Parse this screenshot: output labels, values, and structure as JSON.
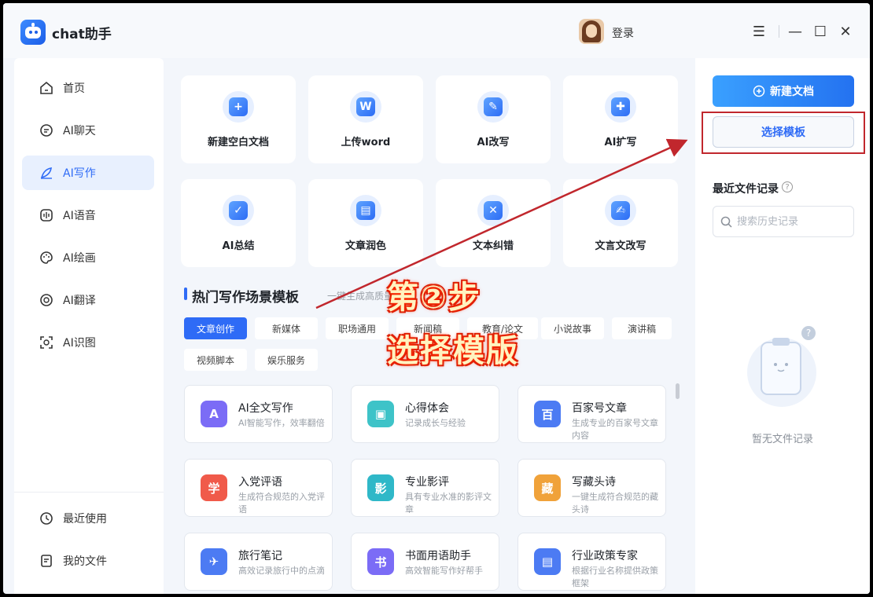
{
  "app": {
    "name": "chat助手",
    "login": "登录"
  },
  "window_controls": {
    "menu": "☰",
    "minimize": "—",
    "maximize": "☐",
    "close": "✕"
  },
  "sidebar": {
    "items": [
      {
        "label": "首页",
        "icon": "home-icon"
      },
      {
        "label": "AI聊天",
        "icon": "chat-icon"
      },
      {
        "label": "AI写作",
        "icon": "pen-icon",
        "active": true
      },
      {
        "label": "AI语音",
        "icon": "voice-icon"
      },
      {
        "label": "AI绘画",
        "icon": "palette-icon"
      },
      {
        "label": "AI翻译",
        "icon": "translate-icon"
      },
      {
        "label": "AI识图",
        "icon": "scan-icon"
      }
    ],
    "bottom": [
      {
        "label": "最近使用",
        "icon": "clock-icon"
      },
      {
        "label": "我的文件",
        "icon": "file-icon"
      }
    ]
  },
  "tools": [
    {
      "label": "新建空白文档",
      "glyph": "+"
    },
    {
      "label": "上传word",
      "glyph": "W"
    },
    {
      "label": "AI改写",
      "glyph": "✎"
    },
    {
      "label": "AI扩写",
      "glyph": "✚"
    },
    {
      "label": "AI总结",
      "glyph": "✓"
    },
    {
      "label": "文章润色",
      "glyph": "▤"
    },
    {
      "label": "文本纠错",
      "glyph": "✕"
    },
    {
      "label": "文言文改写",
      "glyph": "✍"
    }
  ],
  "templates_section": {
    "title": "热门写作场景模板",
    "subtitle": "一键生成高质量"
  },
  "categories": [
    "文章创作",
    "新媒体",
    "职场通用",
    "新闻稿",
    "教育/论文",
    "小说故事",
    "演讲稿",
    "视频脚本",
    "娱乐服务"
  ],
  "template_cards": [
    {
      "title": "AI全文写作",
      "desc": "AI智能写作，效率翻倍",
      "glyph": "A",
      "color": "#7b6cf6"
    },
    {
      "title": "心得体会",
      "desc": "记录成长与经验",
      "glyph": "▣",
      "color": "#3ec3c8"
    },
    {
      "title": "百家号文章",
      "desc": "生成专业的百家号文章内容",
      "glyph": "百",
      "color": "#4c7bf3"
    },
    {
      "title": "入党评语",
      "desc": "生成符合规范的入党评语",
      "glyph": "学",
      "color": "#f05a4a"
    },
    {
      "title": "专业影评",
      "desc": "具有专业水准的影评文章",
      "glyph": "影",
      "color": "#2fb8c8"
    },
    {
      "title": "写藏头诗",
      "desc": "一键生成符合规范的藏头诗",
      "glyph": "藏",
      "color": "#f0a23a"
    },
    {
      "title": "旅行笔记",
      "desc": "高效记录旅行中的点滴",
      "glyph": "✈",
      "color": "#4c7bf3"
    },
    {
      "title": "书面用语助手",
      "desc": "高效智能写作好帮手",
      "glyph": "书",
      "color": "#7b6cf6"
    },
    {
      "title": "行业政策专家",
      "desc": "根据行业名称提供政策框架",
      "glyph": "▤",
      "color": "#4c7bf3"
    }
  ],
  "right_panel": {
    "new_doc": "新建文档",
    "choose_template": "选择模板",
    "recent_title": "最近文件记录",
    "search_placeholder": "搜索历史记录",
    "empty_text": "暂无文件记录"
  },
  "annotation": {
    "step_line1": "第②步",
    "step_line2": "选择模版",
    "color": "#c1272d"
  },
  "colors": {
    "accent": "#2e6bf6",
    "highlight": "#c1272d"
  }
}
